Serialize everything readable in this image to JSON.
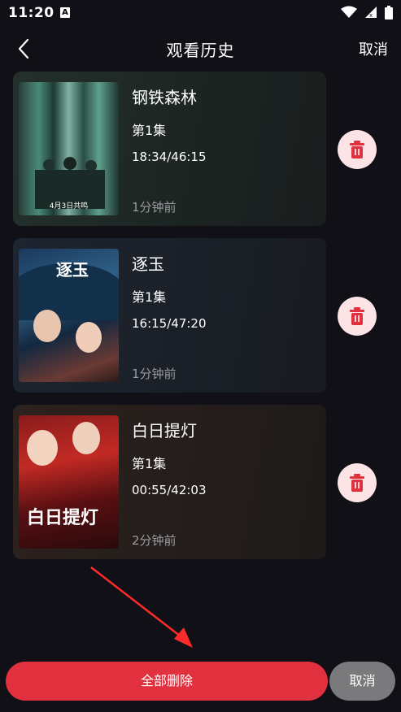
{
  "status_bar": {
    "time": "11:20",
    "notification_glyph": "A"
  },
  "header": {
    "title": "观看历史",
    "cancel_label": "取消"
  },
  "history_items": [
    {
      "title": "钢铁森林",
      "episode": "第1集",
      "progress": "18:34/46:15",
      "watched_ago": "1分钟前",
      "poster_caption": "4月3日共鸣"
    },
    {
      "title": "逐玉",
      "episode": "第1集",
      "progress": "16:15/47:20",
      "watched_ago": "1分钟前",
      "poster_caption": "逐玉"
    },
    {
      "title": "白日提灯",
      "episode": "第1集",
      "progress": "00:55/42:03",
      "watched_ago": "2分钟前",
      "poster_caption": "白日提灯"
    }
  ],
  "footer": {
    "delete_all_label": "全部删除",
    "cancel_label": "取消"
  },
  "colors": {
    "accent": "#e1313f",
    "delete_icon_bg": "#fbe3e6",
    "background": "#101016"
  },
  "icons": [
    "back-chevron-icon",
    "trash-icon",
    "wifi-icon",
    "signal-icon",
    "battery-icon"
  ]
}
